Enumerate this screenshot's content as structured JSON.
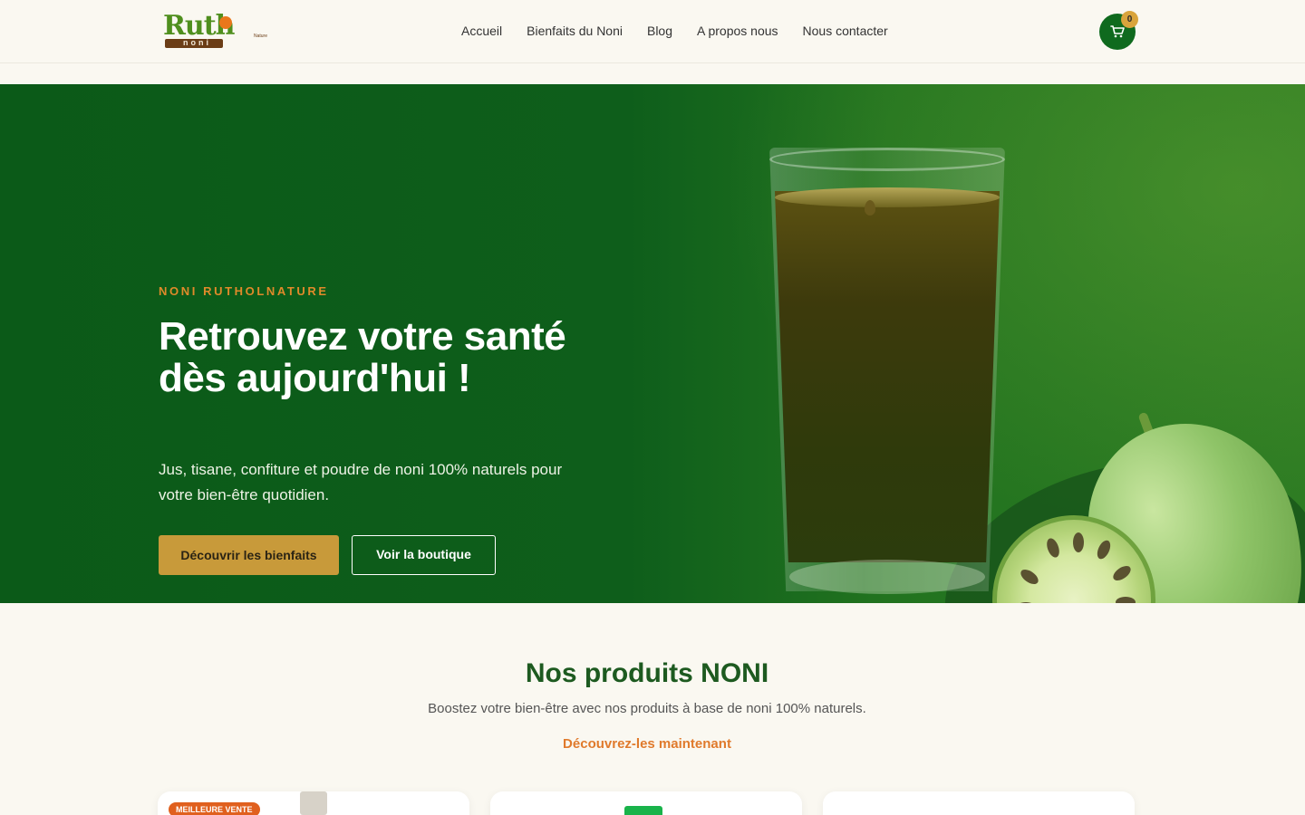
{
  "header": {
    "logo": {
      "main": "Ruth",
      "sub": "noni",
      "tag": "Nature"
    },
    "nav": [
      "Accueil",
      "Bienfaits du Noni",
      "Blog",
      "A propos nous",
      "Nous contacter"
    ],
    "cart_count": "0",
    "icons": {
      "cart": "cart-icon"
    }
  },
  "hero": {
    "eyebrow": "NONI RUTHOLNATURE",
    "title": "Retrouvez votre santé dès aujourd'hui !",
    "subtitle": "Jus, tisane, confiture et poudre de noni 100% naturels pour votre bien-être quotidien.",
    "primary_button": "Découvrir les bienfaits",
    "secondary_button": "Voir la boutique"
  },
  "products": {
    "title": "Nos produits NONI",
    "subtitle": "Boostez votre bien-être avec nos produits à base de noni 100% naturels.",
    "link": "Découvrez-les maintenant",
    "cards": [
      {
        "badge": "MEILLEURE VENTE"
      },
      {},
      {}
    ]
  },
  "colors": {
    "brand_green": "#0f6a1e",
    "accent_orange": "#e08a2a",
    "button_gold": "#c89a3a",
    "background": "#faf8f1"
  }
}
